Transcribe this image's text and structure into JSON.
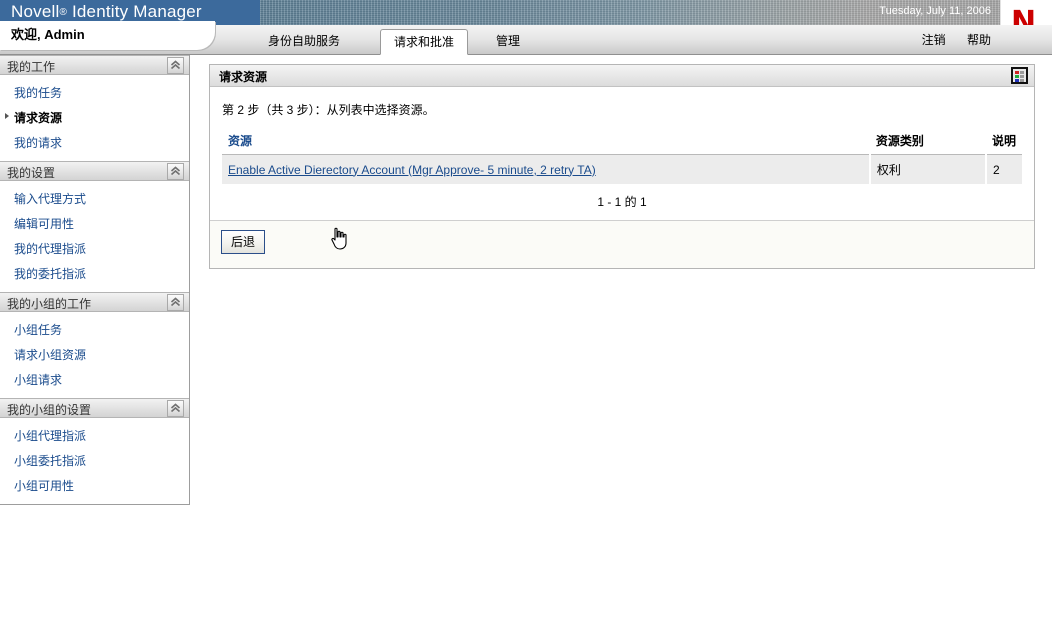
{
  "header": {
    "brand": "Novell",
    "brand_reg": "®",
    "product": "Identity Manager",
    "date": "Tuesday, July 11, 2006",
    "logo_letter": "N",
    "brand_blue": "#3c6a9c",
    "logo_red": "#cc0000"
  },
  "nav": {
    "welcome": "欢迎, Admin",
    "tabs": [
      {
        "label": "身份自助服务",
        "active": false
      },
      {
        "label": "请求和批准",
        "active": true
      },
      {
        "label": "管理",
        "active": false
      }
    ],
    "links": [
      {
        "label": "注销"
      },
      {
        "label": "帮助"
      }
    ]
  },
  "sidebar": {
    "groups": [
      {
        "title": "我的工作",
        "collapse_icon": "chevron-up-double-icon",
        "items": [
          {
            "label": "我的任务",
            "active": false
          },
          {
            "label": "请求资源",
            "active": true
          },
          {
            "label": "我的请求",
            "active": false
          }
        ]
      },
      {
        "title": "我的设置",
        "collapse_icon": "chevron-up-double-icon",
        "items": [
          {
            "label": "输入代理方式",
            "active": false
          },
          {
            "label": "编辑可用性",
            "active": false
          },
          {
            "label": "我的代理指派",
            "active": false
          },
          {
            "label": "我的委托指派",
            "active": false
          }
        ]
      },
      {
        "title": "我的小组的工作",
        "collapse_icon": "chevron-up-double-icon",
        "items": [
          {
            "label": "小组任务",
            "active": false
          },
          {
            "label": "请求小组资源",
            "active": false
          },
          {
            "label": "小组请求",
            "active": false
          }
        ]
      },
      {
        "title": "我的小组的设置",
        "collapse_icon": "chevron-up-double-icon",
        "items": [
          {
            "label": "小组代理指派",
            "active": false
          },
          {
            "label": "小组委托指派",
            "active": false
          },
          {
            "label": "小组可用性",
            "active": false
          }
        ]
      }
    ]
  },
  "main": {
    "card_title": "请求资源",
    "grid_icon": "color-grid-icon",
    "grid_icon_colors": [
      "#cc2222",
      "#9a9a9a",
      "#1faa3c",
      "#9a9a9a",
      "#2233bb",
      "#9a9a9a"
    ],
    "step_text": "第 2 步（共 3 步）：从列表中选择资源。",
    "table": {
      "columns": [
        "资源",
        "资源类别",
        "说明"
      ],
      "rows": [
        {
          "resource": "Enable Active Dierectory Account (Mgr Approve- 5 minute, 2 retry TA)",
          "category": "权利",
          "description": "2"
        }
      ]
    },
    "pager": "1 - 1 的 1",
    "back_button": "后退"
  }
}
